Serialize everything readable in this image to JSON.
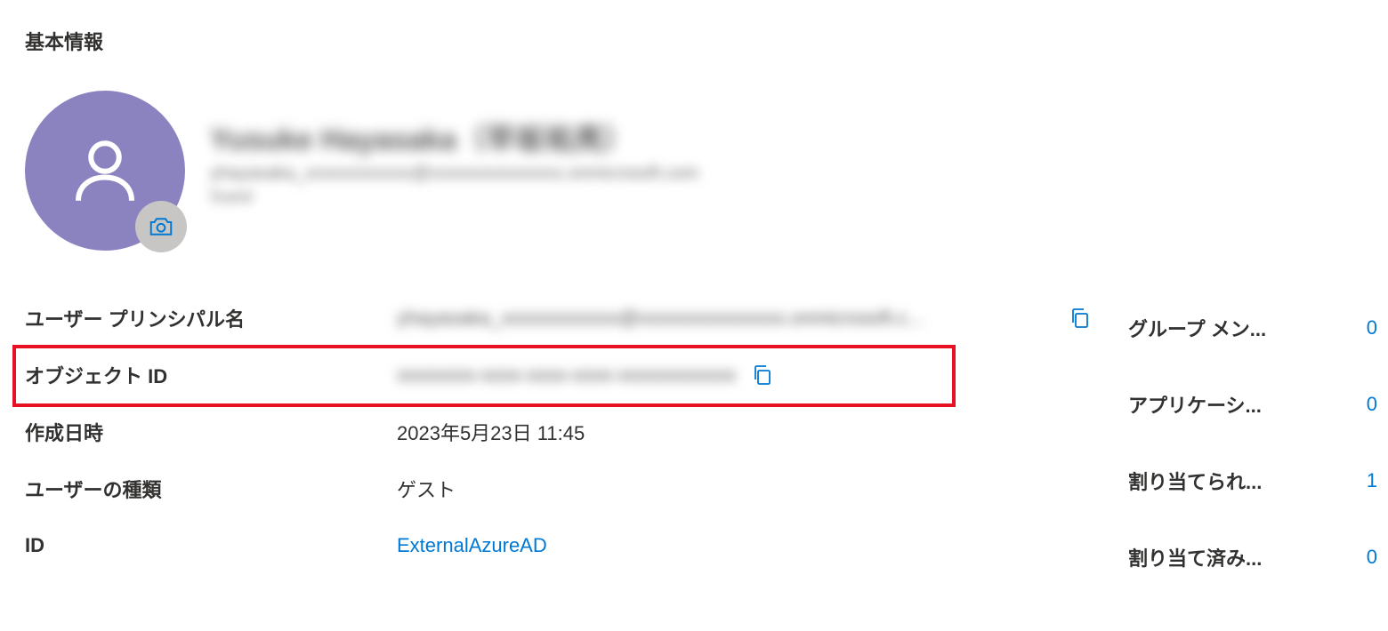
{
  "section_title": "基本情報",
  "profile": {
    "display_name": "Yusuke Hayasaka（早坂祐亮）",
    "upn_sub": "yhayasaka_xxxxxxxxxxxx@xxxxxxxxxxxxxxx.onmicrosoft.com",
    "type_sub": "Guest"
  },
  "props": {
    "upn": {
      "label": "ユーザー プリンシパル名",
      "value": "yhayasaka_xxxxxxxxxxxx@xxxxxxxxxxxxxxx.onmicrosoft.c..."
    },
    "object_id": {
      "label": "オブジェクト ID",
      "value": "xxxxxxxx-xxxx-xxxx-xxxx-xxxxxxxxxxxx"
    },
    "created": {
      "label": "作成日時",
      "value": "2023年5月23日 11:45"
    },
    "user_type": {
      "label": "ユーザーの種類",
      "value": "ゲスト"
    },
    "identity": {
      "label": "ID",
      "value": "ExternalAzureAD"
    }
  },
  "stats": {
    "groups": {
      "label": "グループ メン...",
      "value": "0"
    },
    "apps": {
      "label": "アプリケーシ...",
      "value": "0"
    },
    "assigned_roles": {
      "label": "割り当てられ...",
      "value": "1"
    },
    "assigned_licenses": {
      "label": "割り当て済み...",
      "value": "0"
    }
  }
}
